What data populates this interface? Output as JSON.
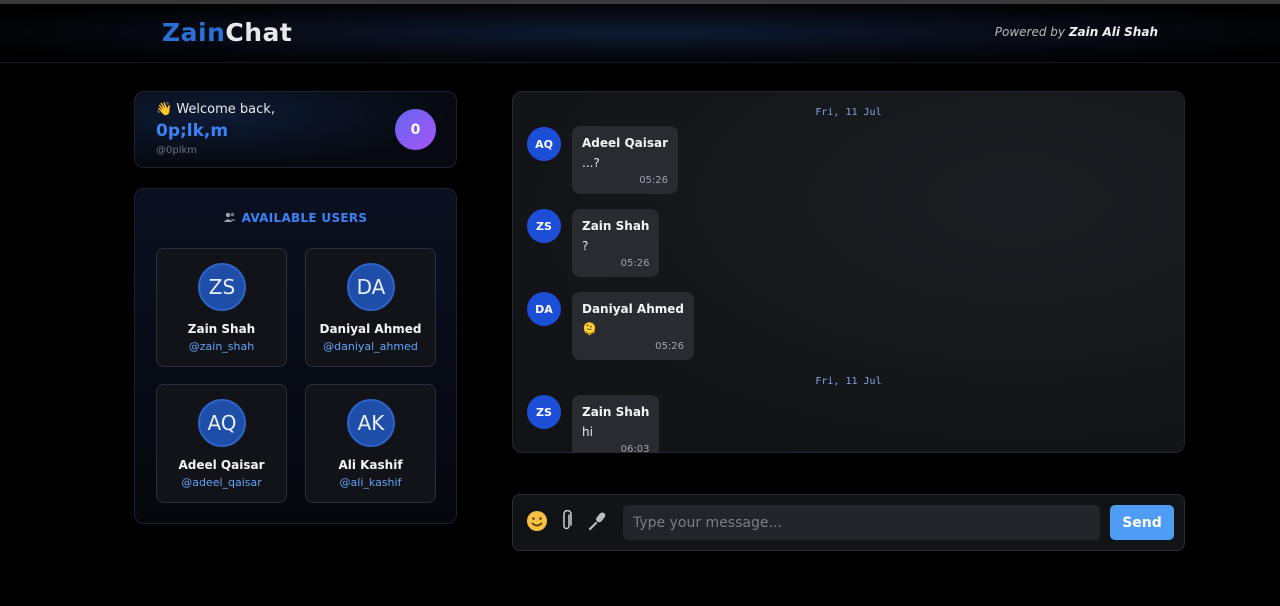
{
  "header": {
    "brand_part1": "Zain",
    "brand_part2": "Chat",
    "powered_prefix": "Powered by ",
    "powered_name": "Zain Ali Shah"
  },
  "welcome": {
    "icon": "wave-emoji",
    "icon_glyph": "👋",
    "label": "Welcome back,",
    "name": "0p;lk,m",
    "handle": "@0plkm",
    "badge": "0"
  },
  "users_panel": {
    "icon": "users-icon",
    "title": "AVAILABLE USERS",
    "users": [
      {
        "initials": "ZS",
        "name": "Zain Shah",
        "handle": "@zain_shah"
      },
      {
        "initials": "DA",
        "name": "Daniyal Ahmed",
        "handle": "@daniyal_ahmed"
      },
      {
        "initials": "AQ",
        "name": "Adeel Qaisar",
        "handle": "@adeel_qaisar"
      },
      {
        "initials": "AK",
        "name": "Ali Kashif",
        "handle": "@ali_kashif"
      }
    ]
  },
  "chat": {
    "date_separators": [
      "Fri, 11 Jul",
      "Fri, 11 Jul"
    ],
    "messages": [
      {
        "initials": "AQ",
        "sender": "Adeel Qaisar",
        "text": "...?",
        "time": "05:26"
      },
      {
        "initials": "ZS",
        "sender": "Zain Shah",
        "text": "?",
        "time": "05:26"
      },
      {
        "initials": "DA",
        "sender": "Daniyal Ahmed",
        "text": "🫠",
        "time": "05:26"
      },
      {
        "initials": "ZS",
        "sender": "Zain Shah",
        "text": "hi",
        "time": "06:03"
      }
    ]
  },
  "composer": {
    "emoji_icon": "emoji-icon",
    "attach_icon": "paperclip-icon",
    "mic_icon": "microphone-icon",
    "placeholder": "Type your message...",
    "value": "",
    "send_label": "Send"
  },
  "colors": {
    "accent": "#3b82f6",
    "avatar": "#1d4ed8",
    "badge_gradient_start": "#6366f1",
    "badge_gradient_end": "#a855f7",
    "send_button": "#4f9cf5"
  }
}
